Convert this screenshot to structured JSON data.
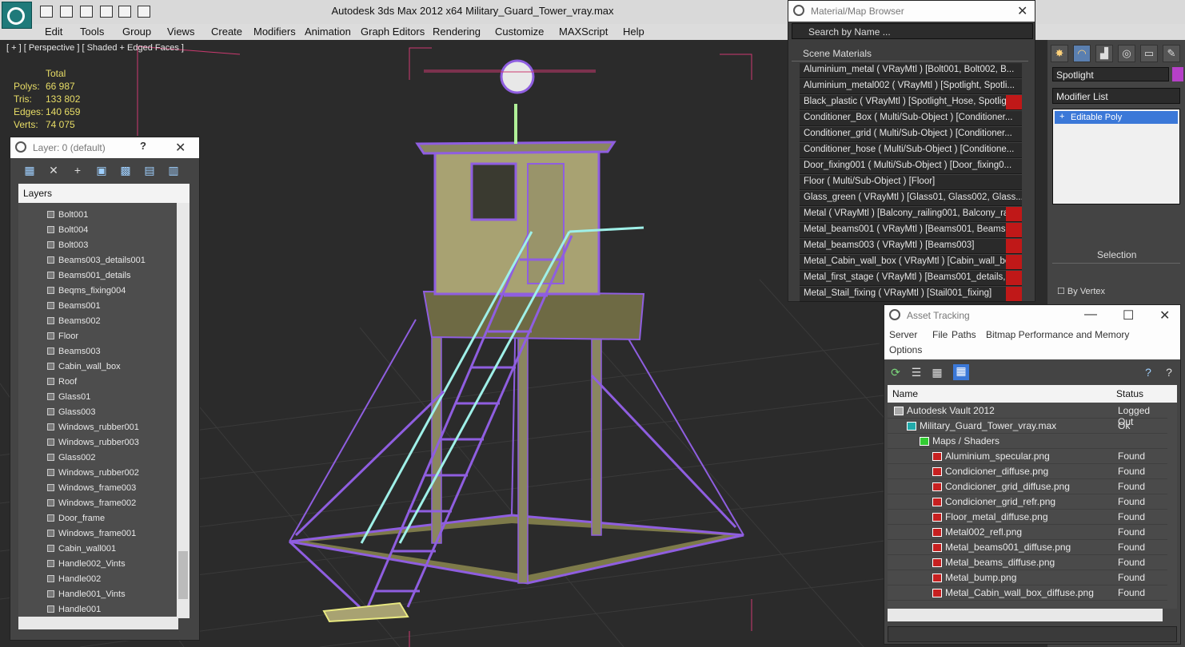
{
  "app": {
    "title": "Autodesk 3ds Max  2012 x64      Military_Guard_Tower_vray.max"
  },
  "menu": [
    "Edit",
    "Tools",
    "Group",
    "Views",
    "Create",
    "Modifiers",
    "Animation",
    "Graph Editors",
    "Rendering",
    "Customize",
    "MAXScript",
    "Help"
  ],
  "viewport": {
    "label": "[ + ] [ Perspective ] [ Shaded + Edged Faces ]",
    "stats": {
      "header": "Total",
      "polys_label": "Polys:",
      "polys": "66 987",
      "tris_label": "Tris:",
      "tris": "133 802",
      "edges_label": "Edges:",
      "edges": "140 659",
      "verts_label": "Verts:",
      "verts": "74 075"
    }
  },
  "layer_window": {
    "title": "Layer: 0 (default)",
    "help": "?",
    "header": "Layers",
    "items": [
      "Bolt001",
      "Bolt004",
      "Bolt003",
      "Beams003_details001",
      "Beams001_details",
      "Beqms_fixing004",
      "Beams001",
      "Beams002",
      "Floor",
      "Beams003",
      "Cabin_wall_box",
      "Roof",
      "Glass01",
      "Glass003",
      "Windows_rubber001",
      "Windows_rubber003",
      "Glass002",
      "Windows_rubber002",
      "Windows_frame003",
      "Windows_frame002",
      "Door_frame",
      "Windows_frame001",
      "Cabin_wall001",
      "Handle002_Vints",
      "Handle002",
      "Handle001_Vints",
      "Handle001"
    ]
  },
  "material_browser": {
    "title": "Material/Map Browser",
    "search_placeholder": "Search by Name ...",
    "section": "Scene Materials",
    "materials": [
      {
        "text": "Aluminium_metal  ( VRayMtl )  [Bolt001, Bolt002, B...",
        "red": false
      },
      {
        "text": "Aluminium_metal002  ( VRayMtl )  [Spotlight, Spotli...",
        "red": false
      },
      {
        "text": "Black_plastic  ( VRayMtl )  [Spotlight_Hose, Spotligh...",
        "red": true
      },
      {
        "text": "Conditioner_Box  ( Multi/Sub-Object )  [Conditioner...",
        "red": false
      },
      {
        "text": "Conditioner_grid  ( Multi/Sub-Object )  [Conditioner...",
        "red": false
      },
      {
        "text": "Conditioner_hose  ( Multi/Sub-Object )  [Conditione...",
        "red": false
      },
      {
        "text": "Door_fixing001  ( Multi/Sub-Object )  [Door_fixing0...",
        "red": false
      },
      {
        "text": "Floor  ( Multi/Sub-Object )  [Floor]",
        "red": false
      },
      {
        "text": "Glass_green  ( VRayMtl )  [Glass01, Glass002, Glass...",
        "red": false
      },
      {
        "text": "Metal  ( VRayMtl )  [Balcony_railing001, Balcony_rai...",
        "red": true
      },
      {
        "text": "Metal_beams001  ( VRayMtl )  [Beams001, Beams0...",
        "red": true
      },
      {
        "text": "Metal_beams003  ( VRayMtl )  [Beams003]",
        "red": true
      },
      {
        "text": "Metal_Cabin_wall_box  ( VRayMtl )  [Cabin_wall_box]",
        "red": true
      },
      {
        "text": "Metal_first_stage  ( VRayMtl )  [Beams001_details,...",
        "red": true
      },
      {
        "text": "Metal_Stail_fixing  ( VRayMtl )  [Stail001_fixing]",
        "red": true
      }
    ]
  },
  "command_panel": {
    "object_name": "Spotlight",
    "object_color": "#b640c8",
    "modifier_list": "Modifier List",
    "modifier_item": "Editable Poly",
    "selection_title": "Selection",
    "by_vertex": "By Vertex"
  },
  "asset_tracking": {
    "title": "Asset Tracking",
    "menu": [
      "Server",
      "File",
      "Paths",
      "Bitmap Performance and Memory",
      "Options"
    ],
    "columns": [
      "Name",
      "Status"
    ],
    "rows": [
      {
        "name": "Autodesk Vault 2012",
        "status": "Logged Out",
        "level": 0,
        "icon": "vault-icon"
      },
      {
        "name": "Military_Guard_Tower_vray.max",
        "status": "Ok",
        "level": 1,
        "icon": "max-file-icon"
      },
      {
        "name": "Maps / Shaders",
        "status": "",
        "level": 2,
        "icon": "maps-folder-icon"
      },
      {
        "name": "Aluminium_specular.png",
        "status": "Found",
        "level": 3,
        "icon": "png-icon"
      },
      {
        "name": "Condicioner_diffuse.png",
        "status": "Found",
        "level": 3,
        "icon": "png-icon"
      },
      {
        "name": "Condicioner_grid_diffuse.png",
        "status": "Found",
        "level": 3,
        "icon": "png-icon"
      },
      {
        "name": "Condicioner_grid_refr.png",
        "status": "Found",
        "level": 3,
        "icon": "png-icon"
      },
      {
        "name": "Floor_metal_diffuse.png",
        "status": "Found",
        "level": 3,
        "icon": "png-icon"
      },
      {
        "name": "Metal002_refl.png",
        "status": "Found",
        "level": 3,
        "icon": "png-icon"
      },
      {
        "name": "Metal_beams001_diffuse.png",
        "status": "Found",
        "level": 3,
        "icon": "png-icon"
      },
      {
        "name": "Metal_beams_diffuse.png",
        "status": "Found",
        "level": 3,
        "icon": "png-icon"
      },
      {
        "name": "Metal_bump.png",
        "status": "Found",
        "level": 3,
        "icon": "png-icon"
      },
      {
        "name": "Metal_Cabin_wall_box_diffuse.png",
        "status": "Found",
        "level": 3,
        "icon": "png-icon"
      }
    ]
  }
}
